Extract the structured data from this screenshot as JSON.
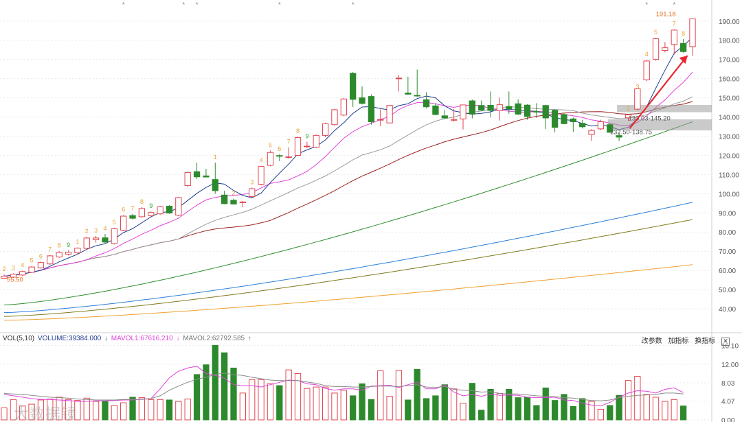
{
  "chart_data": {
    "type": "candlestick",
    "price_axis": {
      "ticks": [
        "190.00",
        "180.00",
        "170.00",
        "160.00",
        "150.00",
        "140.00",
        "130.00",
        "120.00",
        "110.00",
        "100.00",
        "90.00",
        "80.00",
        "70.00",
        "60.00",
        "50.00",
        "40.00"
      ],
      "range": [
        30,
        196
      ]
    },
    "volume_axis": {
      "ticks": [
        "16.10",
        "12.00",
        "8.03",
        "4.07",
        "0.00"
      ],
      "range": [
        0,
        16.6
      ]
    },
    "candles": [
      {
        "o": 55.9,
        "h": 57.9,
        "l": 55.5,
        "c": 57.0
      },
      {
        "o": 56.5,
        "h": 58.5,
        "l": 56.0,
        "c": 58.0
      },
      {
        "o": 57.6,
        "h": 59.9,
        "l": 57.0,
        "c": 59.4
      },
      {
        "o": 59.0,
        "h": 62.3,
        "l": 58.6,
        "c": 61.8
      },
      {
        "o": 61.3,
        "h": 64.6,
        "l": 60.9,
        "c": 64.1
      },
      {
        "o": 63.4,
        "h": 68.1,
        "l": 62.9,
        "c": 67.6
      },
      {
        "o": 67.0,
        "h": 70.2,
        "l": 66.6,
        "c": 69.4
      },
      {
        "o": 68.4,
        "h": 70.4,
        "l": 67.8,
        "c": 69.5
      },
      {
        "o": 69.2,
        "h": 72.0,
        "l": 68.4,
        "c": 71.6
      },
      {
        "o": 71.5,
        "h": 77.5,
        "l": 71.0,
        "c": 76.9
      },
      {
        "o": 76.0,
        "h": 78.0,
        "l": 74.5,
        "c": 76.9
      },
      {
        "o": 77.0,
        "h": 79.0,
        "l": 73.8,
        "c": 74.8
      },
      {
        "o": 74.0,
        "h": 82.2,
        "l": 73.5,
        "c": 81.7
      },
      {
        "o": 81.0,
        "h": 88.8,
        "l": 80.5,
        "c": 88.3
      },
      {
        "o": 88.6,
        "h": 89.5,
        "l": 86.5,
        "c": 87.2
      },
      {
        "o": 88.0,
        "h": 93.0,
        "l": 87.5,
        "c": 92.3
      },
      {
        "o": 88.6,
        "h": 90.8,
        "l": 87.5,
        "c": 90.2
      },
      {
        "o": 89.5,
        "h": 93.6,
        "l": 88.9,
        "c": 93.2
      },
      {
        "o": 93.5,
        "h": 94.0,
        "l": 89.5,
        "c": 89.9
      },
      {
        "o": 88.8,
        "h": 98.4,
        "l": 88.3,
        "c": 98.0
      },
      {
        "o": 104.2,
        "h": 111.5,
        "l": 103.8,
        "c": 111.0
      },
      {
        "o": 111.5,
        "h": 116.2,
        "l": 107.6,
        "c": 108.8
      },
      {
        "o": 109.3,
        "h": 113.0,
        "l": 108.8,
        "c": 108.7
      },
      {
        "o": 107.4,
        "h": 116.2,
        "l": 100.0,
        "c": 101.6
      },
      {
        "o": 99.3,
        "h": 101.5,
        "l": 94.5,
        "c": 94.8
      },
      {
        "o": 96.6,
        "h": 97.4,
        "l": 94.5,
        "c": 94.6
      },
      {
        "o": 95.7,
        "h": 96.2,
        "l": 92.9,
        "c": 95.7
      },
      {
        "o": 98.5,
        "h": 103.2,
        "l": 98.0,
        "c": 102.6
      },
      {
        "o": 104.9,
        "h": 114.6,
        "l": 104.3,
        "c": 114.2
      },
      {
        "o": 114.8,
        "h": 122.5,
        "l": 114.3,
        "c": 121.5
      },
      {
        "o": 119.9,
        "h": 120.6,
        "l": 117.0,
        "c": 119.6
      },
      {
        "o": 119.2,
        "h": 124.2,
        "l": 118.3,
        "c": 119.2
      },
      {
        "o": 120.0,
        "h": 129.8,
        "l": 119.7,
        "c": 129.3
      },
      {
        "o": 124.5,
        "h": 127.1,
        "l": 123.9,
        "c": 124.8
      },
      {
        "o": 124.3,
        "h": 130.8,
        "l": 123.8,
        "c": 130.4
      },
      {
        "o": 130.4,
        "h": 137.0,
        "l": 129.4,
        "c": 136.5
      },
      {
        "o": 136.0,
        "h": 144.3,
        "l": 135.5,
        "c": 143.8
      },
      {
        "o": 141.0,
        "h": 149.9,
        "l": 140.5,
        "c": 149.4
      },
      {
        "o": 162.8,
        "h": 163.5,
        "l": 145.2,
        "c": 149.2
      },
      {
        "o": 150.0,
        "h": 156.0,
        "l": 146.5,
        "c": 147.1
      },
      {
        "o": 150.7,
        "h": 151.8,
        "l": 136.0,
        "c": 137.5
      },
      {
        "o": 138.7,
        "h": 144.0,
        "l": 135.2,
        "c": 138.7
      },
      {
        "o": 136.9,
        "h": 145.2,
        "l": 136.9,
        "c": 146.0
      },
      {
        "o": 160.3,
        "h": 162.0,
        "l": 153.3,
        "c": 160.3
      },
      {
        "o": 152.5,
        "h": 161.0,
        "l": 151.5,
        "c": 151.9
      },
      {
        "o": 151.3,
        "h": 164.7,
        "l": 150.5,
        "c": 151.1
      },
      {
        "o": 149.0,
        "h": 152.9,
        "l": 144.6,
        "c": 145.3
      },
      {
        "o": 145.8,
        "h": 147.2,
        "l": 140.9,
        "c": 141.3
      },
      {
        "o": 140.6,
        "h": 143.6,
        "l": 139.1,
        "c": 139.5
      },
      {
        "o": 138.3,
        "h": 144.1,
        "l": 137.6,
        "c": 138.7
      },
      {
        "o": 139.0,
        "h": 142.4,
        "l": 133.5,
        "c": 146.3
      },
      {
        "o": 148.4,
        "h": 149.1,
        "l": 139.3,
        "c": 141.5
      },
      {
        "o": 146.0,
        "h": 148.6,
        "l": 143.2,
        "c": 143.6
      },
      {
        "o": 146.1,
        "h": 153.3,
        "l": 139.8,
        "c": 143.4
      },
      {
        "o": 143.3,
        "h": 150.1,
        "l": 138.2,
        "c": 146.4
      },
      {
        "o": 145.5,
        "h": 153.3,
        "l": 141.7,
        "c": 144.2
      },
      {
        "o": 146.9,
        "h": 149.2,
        "l": 141.0,
        "c": 141.5
      },
      {
        "o": 146.2,
        "h": 146.7,
        "l": 138.6,
        "c": 140.3
      },
      {
        "o": 142.9,
        "h": 147.2,
        "l": 139.6,
        "c": 142.6
      },
      {
        "o": 146.0,
        "h": 146.3,
        "l": 133.8,
        "c": 139.5
      },
      {
        "o": 143.5,
        "h": 144.1,
        "l": 132.0,
        "c": 134.6
      },
      {
        "o": 141.3,
        "h": 141.9,
        "l": 137.0,
        "c": 136.5
      },
      {
        "o": 139.0,
        "h": 139.8,
        "l": 132.2,
        "c": 137.5
      },
      {
        "o": 136.7,
        "h": 138.5,
        "l": 134.0,
        "c": 134.9
      },
      {
        "o": 130.9,
        "h": 133.7,
        "l": 127.5,
        "c": 133.0
      },
      {
        "o": 133.8,
        "h": 138.6,
        "l": 133.2,
        "c": 137.5
      },
      {
        "o": 136.0,
        "h": 136.6,
        "l": 132.1,
        "c": 132.0
      },
      {
        "o": 130.3,
        "h": 131.7,
        "l": 127.5,
        "c": 129.5
      },
      {
        "o": 139.6,
        "h": 141.5,
        "l": 138.0,
        "c": 141.2
      },
      {
        "o": 144.1,
        "h": 152.9,
        "l": 143.6,
        "c": 154.7
      },
      {
        "o": 159.4,
        "h": 169.8,
        "l": 158.8,
        "c": 169.2
      },
      {
        "o": 170.0,
        "h": 181.3,
        "l": 169.4,
        "c": 180.8
      },
      {
        "o": 174.7,
        "h": 179.1,
        "l": 173.7,
        "c": 176.1
      },
      {
        "o": 177.8,
        "h": 185.8,
        "l": 172.5,
        "c": 185.3
      },
      {
        "o": 178.4,
        "h": 180.6,
        "l": 173.5,
        "c": 174.1
      },
      {
        "o": 176.7,
        "h": 191.2,
        "l": 171.9,
        "c": 191.2
      }
    ],
    "td_counts": [
      {
        "label": "2",
        "index": 0,
        "color": "#e8a33a"
      },
      {
        "label": "3",
        "index": 1,
        "color": "#e8a33a"
      },
      {
        "label": "4",
        "index": 2,
        "color": "#e8a33a"
      },
      {
        "label": "5",
        "index": 3,
        "color": "#e8a33a"
      },
      {
        "label": "6",
        "index": 4,
        "color": "#e8a33a"
      },
      {
        "label": "7",
        "index": 5,
        "color": "#e8a33a"
      },
      {
        "label": "8",
        "index": 6,
        "color": "#e8a33a"
      },
      {
        "label": "9",
        "index": 7,
        "color": "#2aa52a"
      },
      {
        "label": "1",
        "index": 8,
        "color": "#e8a33a"
      },
      {
        "label": "2",
        "index": 9,
        "color": "#e8a33a"
      },
      {
        "label": "3",
        "index": 10,
        "color": "#e8a33a"
      },
      {
        "label": "4",
        "index": 11,
        "color": "#e8a33a"
      },
      {
        "label": "5",
        "index": 12,
        "color": "#e8a33a"
      },
      {
        "label": "6",
        "index": 13,
        "color": "#e8a33a"
      },
      {
        "label": "7",
        "index": 14,
        "color": "#e8a33a"
      },
      {
        "label": "8",
        "index": 15,
        "color": "#e8a33a"
      },
      {
        "label": "9",
        "index": 16,
        "color": "#2aa52a"
      },
      {
        "label": "1",
        "index": 23,
        "color": "#e8a33a"
      },
      {
        "label": "2",
        "index": 25,
        "color": "#e8a33a"
      },
      {
        "label": "3",
        "index": 27,
        "color": "#e8a33a"
      },
      {
        "label": "4",
        "index": 28,
        "color": "#e8a33a"
      },
      {
        "label": "5",
        "index": 29,
        "color": "#e8a33a"
      },
      {
        "label": "6",
        "index": 30,
        "color": "#e8a33a"
      },
      {
        "label": "7",
        "index": 31,
        "color": "#e8a33a"
      },
      {
        "label": "8",
        "index": 32,
        "color": "#e8a33a"
      },
      {
        "label": "9",
        "index": 33,
        "color": "#2aa52a"
      },
      {
        "label": "2",
        "index": 68,
        "color": "#e8a33a"
      },
      {
        "label": "3",
        "index": 69,
        "color": "#e8a33a"
      },
      {
        "label": "4",
        "index": 70,
        "color": "#e8a33a"
      },
      {
        "label": "5",
        "index": 71,
        "color": "#e8a33a"
      },
      {
        "label": "7",
        "index": 73,
        "color": "#e8a33a"
      },
      {
        "label": "8",
        "index": 74,
        "color": "#e8a33a"
      }
    ],
    "annotations": [
      {
        "text": "191.18",
        "price": 191.18,
        "index": 74,
        "color": "#e36c1b"
      },
      {
        "text": "130.03-145.20",
        "price": 140.0,
        "index": 68,
        "color": "#555555"
      },
      {
        "text": "132.50-138.75",
        "price": 132.5,
        "index": 66,
        "color": "#555555"
      },
      {
        "text": "55.50",
        "price": 55.5,
        "index": 0,
        "color": "#e36c1b"
      }
    ],
    "zones": [
      {
        "low": 142.5,
        "high": 146.3,
        "from_index": 67
      },
      {
        "low": 133.0,
        "high": 138.8,
        "from_index": 66
      }
    ],
    "stars": [
      13,
      20,
      21,
      30,
      38,
      70,
      73
    ],
    "volume": {
      "legend": {
        "title": "VOL(5,10)",
        "volume": "VOLUME:39384.000",
        "mavol1": "MAVOL1:67616.210",
        "mavol2": "MAVOL2:62792.585"
      },
      "controls": [
        "改参数",
        "加指标",
        "换指标"
      ],
      "values": [
        2.6,
        4.4,
        3.0,
        3.4,
        4.3,
        4.5,
        4.9,
        4.4,
        4.2,
        4.7,
        4.0,
        4.0,
        3.1,
        3.7,
        4.9,
        4.8,
        4.4,
        4.4,
        4.3,
        4.0,
        4.5,
        9.8,
        11.9,
        16.1,
        14.5,
        11.2,
        5.8,
        8.7,
        8.7,
        7.8,
        7.4,
        10.8,
        10.0,
        6.8,
        7.1,
        7.1,
        5.8,
        6.4,
        5.2,
        7.8,
        4.4,
        10.6,
        5.1,
        10.7,
        4.3,
        10.9,
        4.6,
        5.2,
        7.6,
        6.7,
        3.6,
        7.9,
        2.1,
        6.6,
        5.7,
        6.6,
        4.8,
        4.9,
        3.1,
        6.9,
        4.2,
        5.5,
        2.9,
        4.6,
        4.0,
        2.3,
        3.1,
        5.3,
        8.5,
        9.4,
        5.5,
        4.9,
        4.0,
        4.4,
        3.0
      ],
      "mavol1": [
        5.5,
        5.2,
        4.9,
        4.6,
        4.4,
        4.4,
        4.3,
        4.2,
        4.0,
        4.0,
        4.1,
        4.1,
        4.2,
        4.3,
        4.3,
        4.5,
        4.6,
        6.7,
        9.1,
        10.5,
        11.2,
        11.6,
        10.0,
        9.6,
        9.0,
        7.6,
        7.4,
        7.4,
        7.1,
        7.6,
        8.1,
        8.6,
        8.5,
        7.8,
        7.6,
        6.8,
        6.4,
        6.7,
        6.7,
        6.4,
        7.3,
        7.4,
        7.5,
        7.0,
        7.6,
        8.1,
        6.7,
        6.7,
        7.6,
        6.0,
        5.2,
        5.5,
        5.1,
        5.6,
        5.3,
        5.4,
        5.3,
        4.9,
        4.8,
        4.8,
        4.9,
        4.3,
        4.2,
        3.6,
        3.2,
        3.0,
        3.8,
        4.9,
        5.8,
        6.3,
        6.2,
        5.8,
        6.6,
        6.9,
        5.9
      ],
      "mavol2": [
        5.7,
        5.6,
        5.5,
        5.3,
        5.1,
        4.9,
        4.8,
        4.7,
        4.5,
        4.4,
        4.3,
        4.3,
        4.3,
        4.4,
        4.4,
        4.4,
        4.6,
        5.2,
        6.4,
        7.3,
        8.1,
        8.8,
        9.2,
        9.8,
        10.1,
        9.8,
        9.6,
        9.2,
        8.9,
        8.6,
        8.5,
        8.5,
        8.5,
        8.2,
        7.9,
        7.4,
        7.2,
        7.2,
        7.1,
        7.1,
        7.2,
        7.3,
        7.3,
        7.2,
        7.4,
        7.6,
        7.1,
        7.0,
        7.2,
        6.6,
        6.4,
        6.3,
        6.0,
        6.1,
        5.7,
        5.6,
        5.6,
        5.4,
        5.2,
        5.1,
        5.0,
        4.8,
        4.7,
        4.4,
        4.2,
        4.1,
        4.3,
        4.8,
        5.1,
        5.3,
        5.4,
        5.5,
        5.8,
        5.8,
        5.6
      ]
    },
    "watermark": "大数据镜"
  },
  "colors": {
    "up": "#e0454f",
    "down": "#2c8a2c",
    "ma5": "#1f3b8f",
    "ma10": "#e042d9",
    "ma20": "#9a9a9a",
    "ma30": "#9b2020",
    "ma60": "#2f8f2f",
    "ma120": "#2b7fd8",
    "ma250": "#7f7a1c",
    "ma_long": "#f0a030",
    "grid": "#e9e9e9",
    "axis_text": "#555555",
    "arrow": "#e8262e"
  }
}
